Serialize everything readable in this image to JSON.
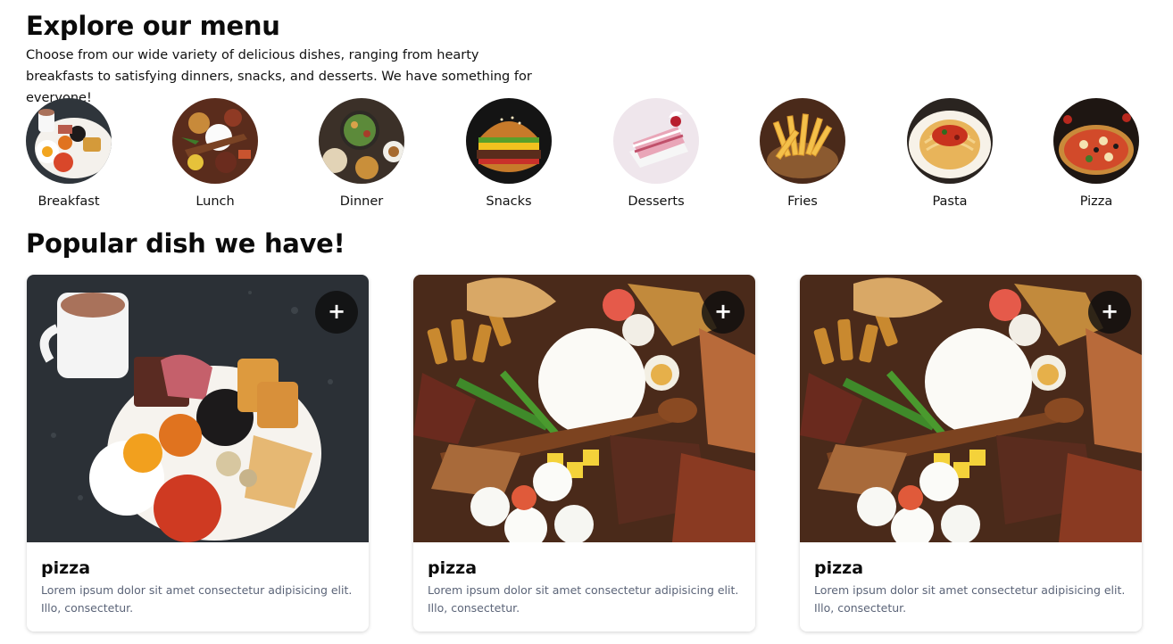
{
  "header": {
    "title": "Explore our menu",
    "intro": "Choose from our wide variety of delicious dishes, ranging from hearty breakfasts to satisfying dinners, snacks, and desserts. We have something for everyone!"
  },
  "categories": [
    {
      "label": "Breakfast"
    },
    {
      "label": "Lunch"
    },
    {
      "label": "Dinner"
    },
    {
      "label": "Snacks"
    },
    {
      "label": "Desserts"
    },
    {
      "label": "Fries"
    },
    {
      "label": "Pasta"
    },
    {
      "label": "Pizza"
    }
  ],
  "popular": {
    "title": "Popular dish we have!",
    "cards": [
      {
        "title": "pizza",
        "description": "Lorem ipsum dolor sit amet consectetur adipisicing elit. Illo, consectetur.",
        "add_label": "+",
        "image": "breakfast-photo"
      },
      {
        "title": "pizza",
        "description": "Lorem ipsum dolor sit amet consectetur adipisicing elit. Illo, consectetur.",
        "add_label": "+",
        "image": "platter-photo"
      },
      {
        "title": "pizza",
        "description": "Lorem ipsum dolor sit amet consectetur adipisicing elit. Illo, consectetur.",
        "add_label": "+",
        "image": "platter-photo"
      }
    ]
  }
}
